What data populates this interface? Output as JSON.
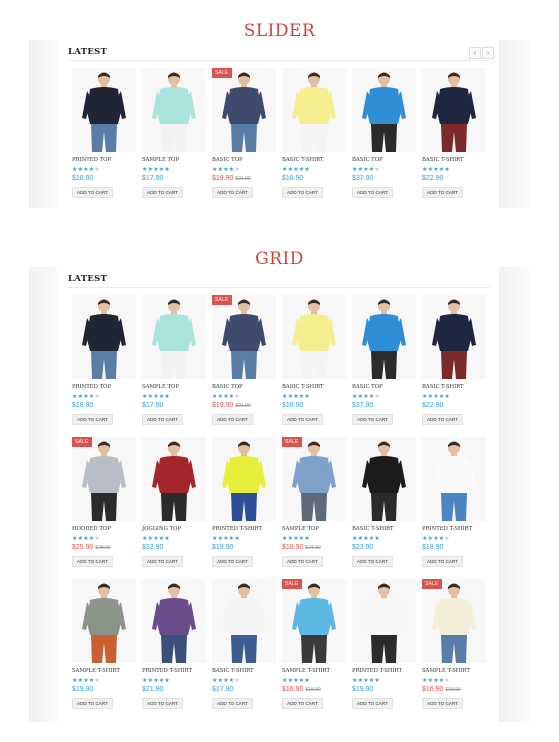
{
  "sections": {
    "slider_title": "SLIDER",
    "grid_title": "GRID"
  },
  "slider": {
    "heading": "LATEST",
    "prev_icon": "chevron-left-icon",
    "next_icon": "chevron-right-icon",
    "products": [
      {
        "name": "PRINTED TOP",
        "price": "$18.90",
        "old_price": "",
        "sale": false,
        "rating": 4,
        "shirt": "#1f2533",
        "pants": "#5a7da8",
        "sale_label": ""
      },
      {
        "name": "SAMPLE TOP",
        "price": "$17.90",
        "old_price": "",
        "sale": false,
        "rating": 5,
        "shirt": "#a9e3d9",
        "pants": "#f2f2f2",
        "sale_label": ""
      },
      {
        "name": "BASIC TOP",
        "price": "$19.90",
        "old_price": "$21.90",
        "sale": true,
        "rating": 4,
        "shirt": "#3f4b6e",
        "pants": "#5a7da8",
        "sale_label": "SALE"
      },
      {
        "name": "BASIC T-SHIRT",
        "price": "$18.90",
        "old_price": "",
        "sale": false,
        "rating": 5,
        "shirt": "#f3ef8e",
        "pants": "#f4f4f4",
        "sale_label": ""
      },
      {
        "name": "BASIC TOP",
        "price": "$37.90",
        "old_price": "",
        "sale": false,
        "rating": 4,
        "shirt": "#2e8fd6",
        "pants": "#2b2b2b",
        "sale_label": ""
      },
      {
        "name": "BASIC T-SHIRT",
        "price": "$22.90",
        "old_price": "",
        "sale": false,
        "rating": 5,
        "shirt": "#1e2640",
        "pants": "#7a2a2a",
        "sale_label": ""
      }
    ]
  },
  "grid": {
    "heading": "LATEST",
    "products": [
      {
        "name": "PRINTED TOP",
        "price": "$18.90",
        "old_price": "",
        "sale": false,
        "rating": 4,
        "shirt": "#1f2533",
        "pants": "#5a7da8",
        "sale_label": ""
      },
      {
        "name": "SAMPLE TOP",
        "price": "$17.90",
        "old_price": "",
        "sale": false,
        "rating": 5,
        "shirt": "#a9e3d9",
        "pants": "#f2f2f2",
        "sale_label": ""
      },
      {
        "name": "BASIC TOP",
        "price": "$19.90",
        "old_price": "$21.90",
        "sale": true,
        "rating": 4,
        "shirt": "#3f4b6e",
        "pants": "#5a7da8",
        "sale_label": "SALE"
      },
      {
        "name": "BASIC T-SHIRT",
        "price": "$18.90",
        "old_price": "",
        "sale": false,
        "rating": 5,
        "shirt": "#f3ef8e",
        "pants": "#f4f4f4",
        "sale_label": ""
      },
      {
        "name": "BASIC TOP",
        "price": "$37.90",
        "old_price": "",
        "sale": false,
        "rating": 4,
        "shirt": "#2e8fd6",
        "pants": "#2b2b2b",
        "sale_label": ""
      },
      {
        "name": "BASIC T-SHIRT",
        "price": "$22.90",
        "old_price": "",
        "sale": false,
        "rating": 5,
        "shirt": "#1e2640",
        "pants": "#7a2a2a",
        "sale_label": ""
      },
      {
        "name": "HOODED TOP",
        "price": "$25.90",
        "old_price": "$28.90",
        "sale": true,
        "rating": 4,
        "shirt": "#b9bec6",
        "pants": "#2b2b2b",
        "sale_label": "SALE"
      },
      {
        "name": "JOGGING TOP",
        "price": "$32.90",
        "old_price": "",
        "sale": false,
        "rating": 5,
        "shirt": "#a3262c",
        "pants": "#2b2b2b",
        "sale_label": ""
      },
      {
        "name": "PRINTED T-SHIRT",
        "price": "$19.90",
        "old_price": "",
        "sale": false,
        "rating": 5,
        "shirt": "#e8ef3a",
        "pants": "#2d4f9a",
        "sale_label": ""
      },
      {
        "name": "SAMPLE TOP",
        "price": "$18.90",
        "old_price": "$21.90",
        "sale": true,
        "rating": 5,
        "shirt": "#7fa0c8",
        "pants": "#5e6a78",
        "sale_label": "SALE"
      },
      {
        "name": "BASIC T-SHIRT",
        "price": "$23.90",
        "old_price": "",
        "sale": false,
        "rating": 5,
        "shirt": "#1c1c1c",
        "pants": "#2b2b2b",
        "sale_label": ""
      },
      {
        "name": "PRINTED T-SHIRT",
        "price": "$18.90",
        "old_price": "",
        "sale": false,
        "rating": 4,
        "shirt": "#fafafa",
        "pants": "#4d84c4",
        "sale_label": ""
      },
      {
        "name": "SAMPLE T-SHIRT",
        "price": "$19.90",
        "old_price": "",
        "sale": false,
        "rating": 4,
        "shirt": "#8a9488",
        "pants": "#c8612f",
        "sale_label": ""
      },
      {
        "name": "PRINTED T-SHIRT",
        "price": "$21.90",
        "old_price": "",
        "sale": false,
        "rating": 5,
        "shirt": "#6a4d8a",
        "pants": "#3a4f7a",
        "sale_label": ""
      },
      {
        "name": "BASIC T-SHIRT",
        "price": "$17.90",
        "old_price": "",
        "sale": false,
        "rating": 4,
        "shirt": "#f4f4f4",
        "pants": "#3c5d92",
        "sale_label": ""
      },
      {
        "name": "SAMPLE T-SHIRT",
        "price": "$16.90",
        "old_price": "$18.90",
        "sale": true,
        "rating": 5,
        "shirt": "#5db8e3",
        "pants": "#3a3a3a",
        "sale_label": "SALE"
      },
      {
        "name": "PRINTED T-SHIRT",
        "price": "$19.90",
        "old_price": "",
        "sale": false,
        "rating": 5,
        "shirt": "#f6f6f6",
        "pants": "#2b2b2b",
        "sale_label": ""
      },
      {
        "name": "SAMPLE T-SHIRT",
        "price": "$16.90",
        "old_price": "$18.90",
        "sale": true,
        "rating": 4,
        "shirt": "#f3efd9",
        "pants": "#5a7da8",
        "sale_label": "SALE"
      }
    ]
  },
  "labels": {
    "add_to_cart": "ADD TO CART"
  },
  "colors": {
    "accent_red": "#c9453b",
    "price_blue": "#3a9dd6",
    "sale_red": "#d9534f"
  }
}
